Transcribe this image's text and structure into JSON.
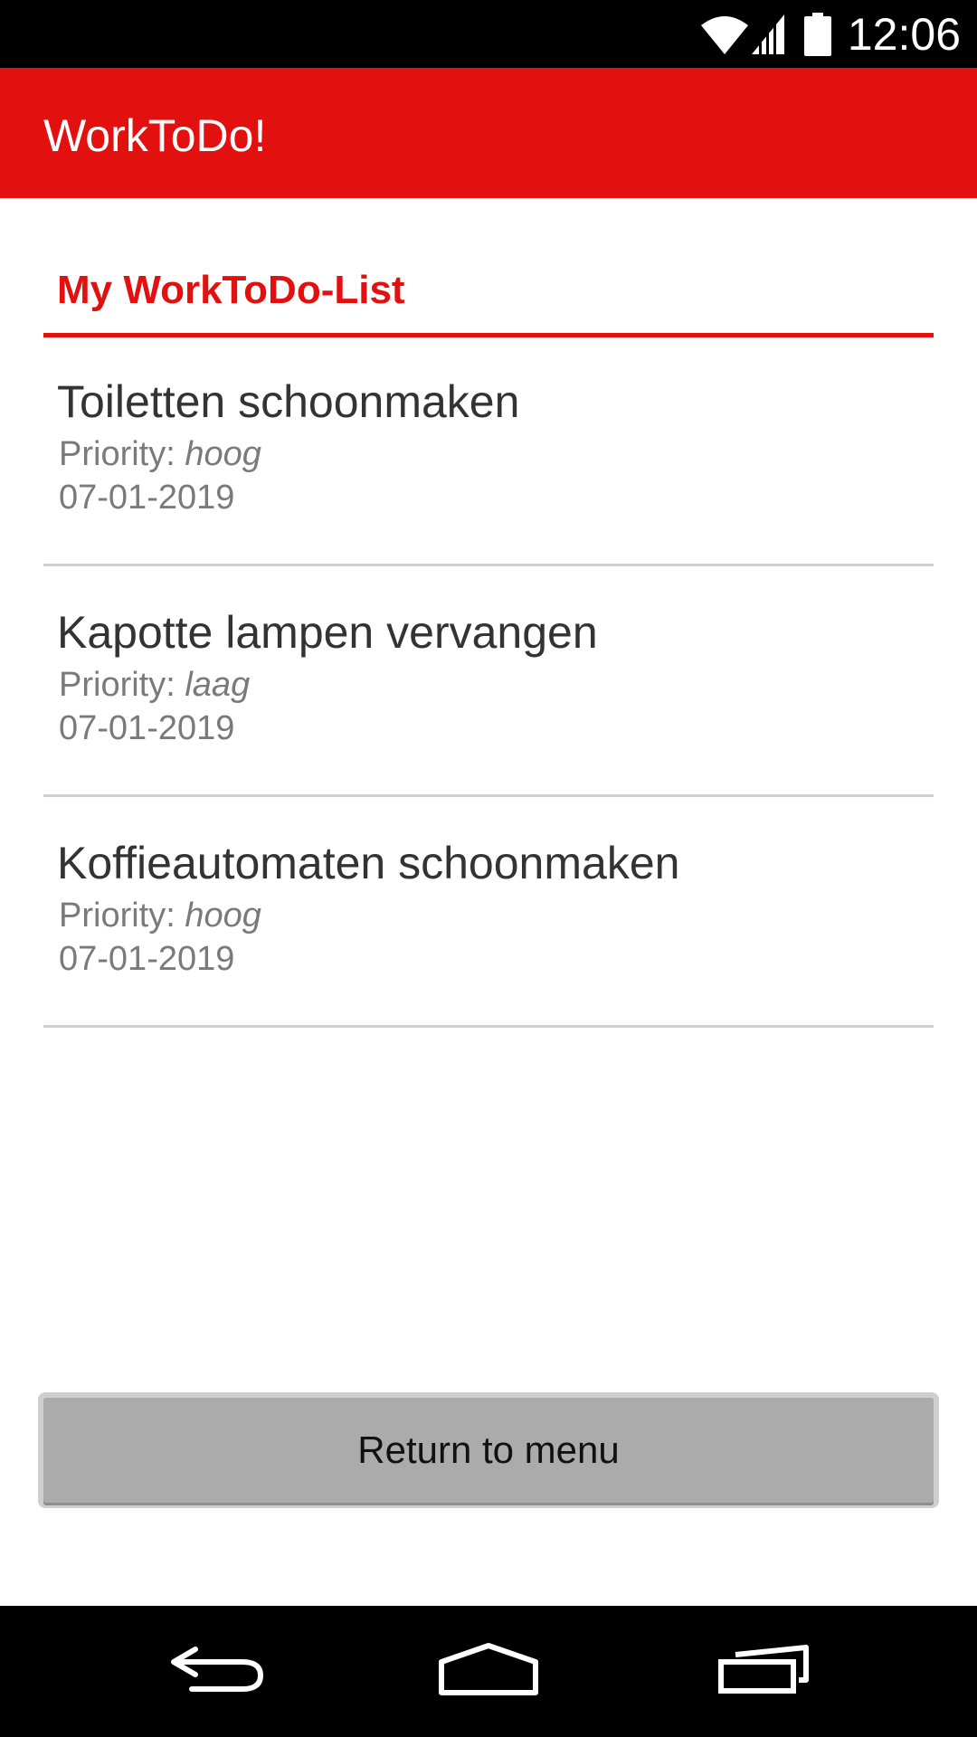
{
  "status_bar": {
    "time": "12:06",
    "icons": [
      "wifi-icon",
      "signal-icon",
      "battery-icon"
    ]
  },
  "app_bar": {
    "title": "WorkToDo!"
  },
  "section": {
    "title": "My WorkToDo-List"
  },
  "tasks": [
    {
      "title": "Toiletten schoonmaken",
      "priority_label": "Priority: ",
      "priority_value": "hoog",
      "date": "07-01-2019"
    },
    {
      "title": "Kapotte lampen vervangen",
      "priority_label": "Priority: ",
      "priority_value": "laag",
      "date": "07-01-2019"
    },
    {
      "title": "Koffieautomaten schoonmaken",
      "priority_label": "Priority: ",
      "priority_value": "hoog",
      "date": "07-01-2019"
    }
  ],
  "return_button": {
    "label": "Return to menu"
  },
  "nav_bar": {
    "icons": [
      "back-icon",
      "home-icon",
      "recents-icon"
    ]
  },
  "colors": {
    "accent": "#e31010",
    "status_bar": "#000000",
    "button": "#ababab",
    "divider": "#cfcfcf"
  }
}
